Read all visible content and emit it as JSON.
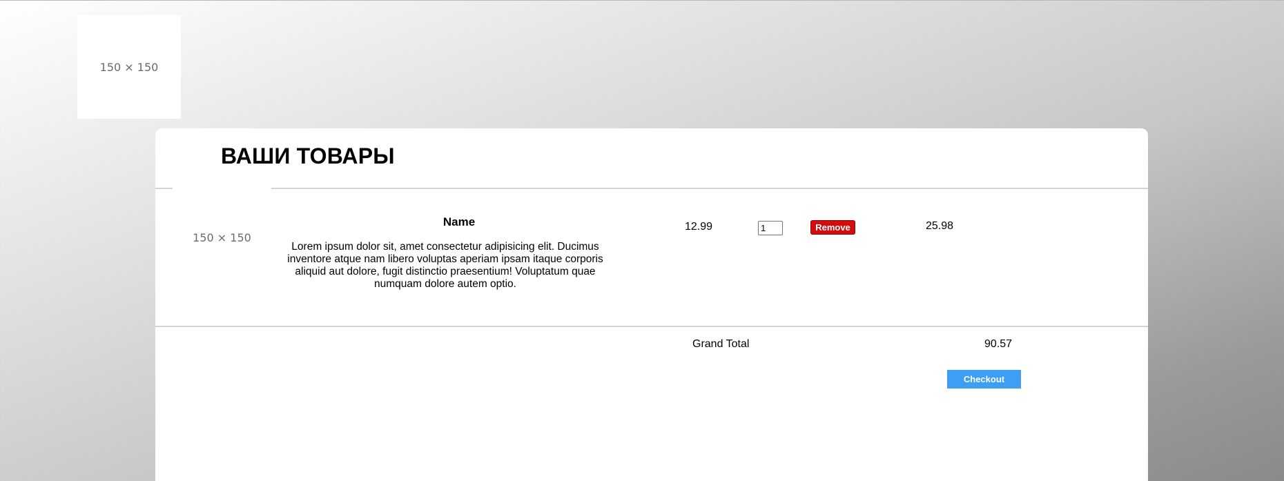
{
  "header": {
    "logo_placeholder": "150 × 150"
  },
  "cart": {
    "title": "ВАШИ ТОВАРЫ",
    "items": [
      {
        "image_placeholder": "150 × 150",
        "name": "Name",
        "description": "Lorem ipsum dolor sit, amet consectetur adipisicing elit. Ducimus inventore atque nam libero voluptas aperiam ipsam itaque corporis aliquid aut dolore, fugit distinctio praesentium! Voluptatum quae numquam dolore autem optio.",
        "price": "12.99",
        "quantity": "1",
        "remove_label": "Remove",
        "line_total": "25.98"
      }
    ],
    "grand_total_label": "Grand Total",
    "grand_total_value": "90.57",
    "checkout_label": "Checkout"
  },
  "colors": {
    "remove_button": "#d20d0d",
    "checkout_button": "#3e9ef3"
  }
}
